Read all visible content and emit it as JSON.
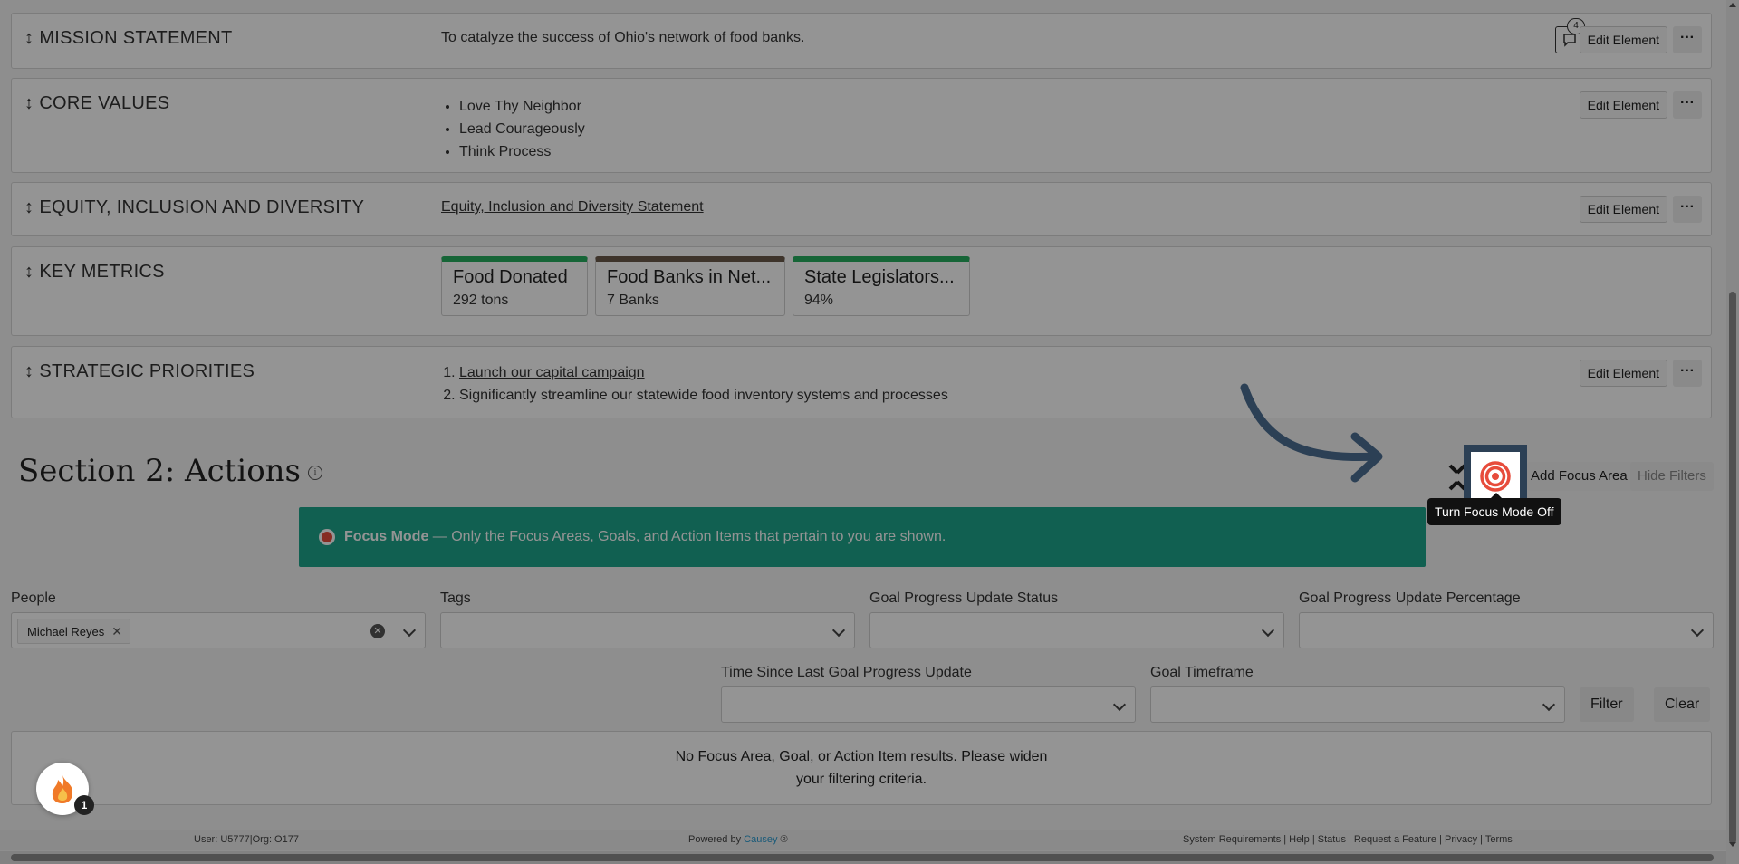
{
  "elements": [
    {
      "label": "MISSION STATEMENT",
      "text": "To catalyze the success of Ohio's network of food banks.",
      "comment_count": "4",
      "edit_label": "Edit Element",
      "more_label": "···"
    },
    {
      "label": "CORE VALUES",
      "items": [
        "Love Thy Neighbor",
        "Lead Courageously",
        "Think Process"
      ],
      "edit_label": "Edit Element",
      "more_label": "···"
    },
    {
      "label": "EQUITY, INCLUSION AND DIVERSITY",
      "link": "Equity, Inclusion and Diversity Statement",
      "edit_label": "Edit Element",
      "more_label": "···"
    },
    {
      "label": "KEY METRICS",
      "metrics": [
        {
          "title": "Food Donated",
          "value": "292 tons",
          "color": "#27ae60"
        },
        {
          "title": "Food Banks in Net...",
          "value": "7 Banks",
          "color": "#6b5a4a"
        },
        {
          "title": "State Legislators...",
          "value": "94%",
          "color": "#27ae60"
        }
      ]
    },
    {
      "label": "STRATEGIC PRIORITIES",
      "items": [
        "Launch our capital campaign",
        "Significantly streamline our statewide food inventory systems and processes"
      ],
      "edit_label": "Edit Element",
      "more_label": "···"
    }
  ],
  "drag_glyph": "↕",
  "section": {
    "title": "Section 2: Actions",
    "info_icon": "i",
    "add_focus_label": "Add Focus Area",
    "hide_filters_label": "Hide Filters",
    "tooltip": "Turn Focus Mode Off"
  },
  "focus_banner": {
    "title": "Focus Mode",
    "text": " — Only the Focus Areas, Goals, and Action Items that pertain to you are shown."
  },
  "filters": {
    "people": {
      "label": "People",
      "chip": "Michael Reyes",
      "chip_remove": "✕",
      "clear": "✕"
    },
    "tags": {
      "label": "Tags"
    },
    "goal_status": {
      "label": "Goal Progress Update Status"
    },
    "goal_percentage": {
      "label": "Goal Progress Update Percentage"
    },
    "time_since": {
      "label": "Time Since Last Goal Progress Update"
    },
    "timeframe": {
      "label": "Goal Timeframe"
    },
    "filter_label": "Filter",
    "clear_label": "Clear"
  },
  "results": {
    "line1": "No Focus Area, Goal, or Action Item results. Please widen",
    "line2": "your filtering criteria."
  },
  "fab": {
    "badge": "1"
  },
  "footer": {
    "user": "User: U5777|Org: O177",
    "powered_prefix": "Powered by ",
    "brand": "Causey",
    "brand_mark": " ®",
    "links": "System Requirements | Help | Status | Request a Feature | Privacy | Terms"
  },
  "colors": {
    "banner": "#1ea58c",
    "accent_dark": "#2c4055",
    "target": "#e74c3c"
  }
}
